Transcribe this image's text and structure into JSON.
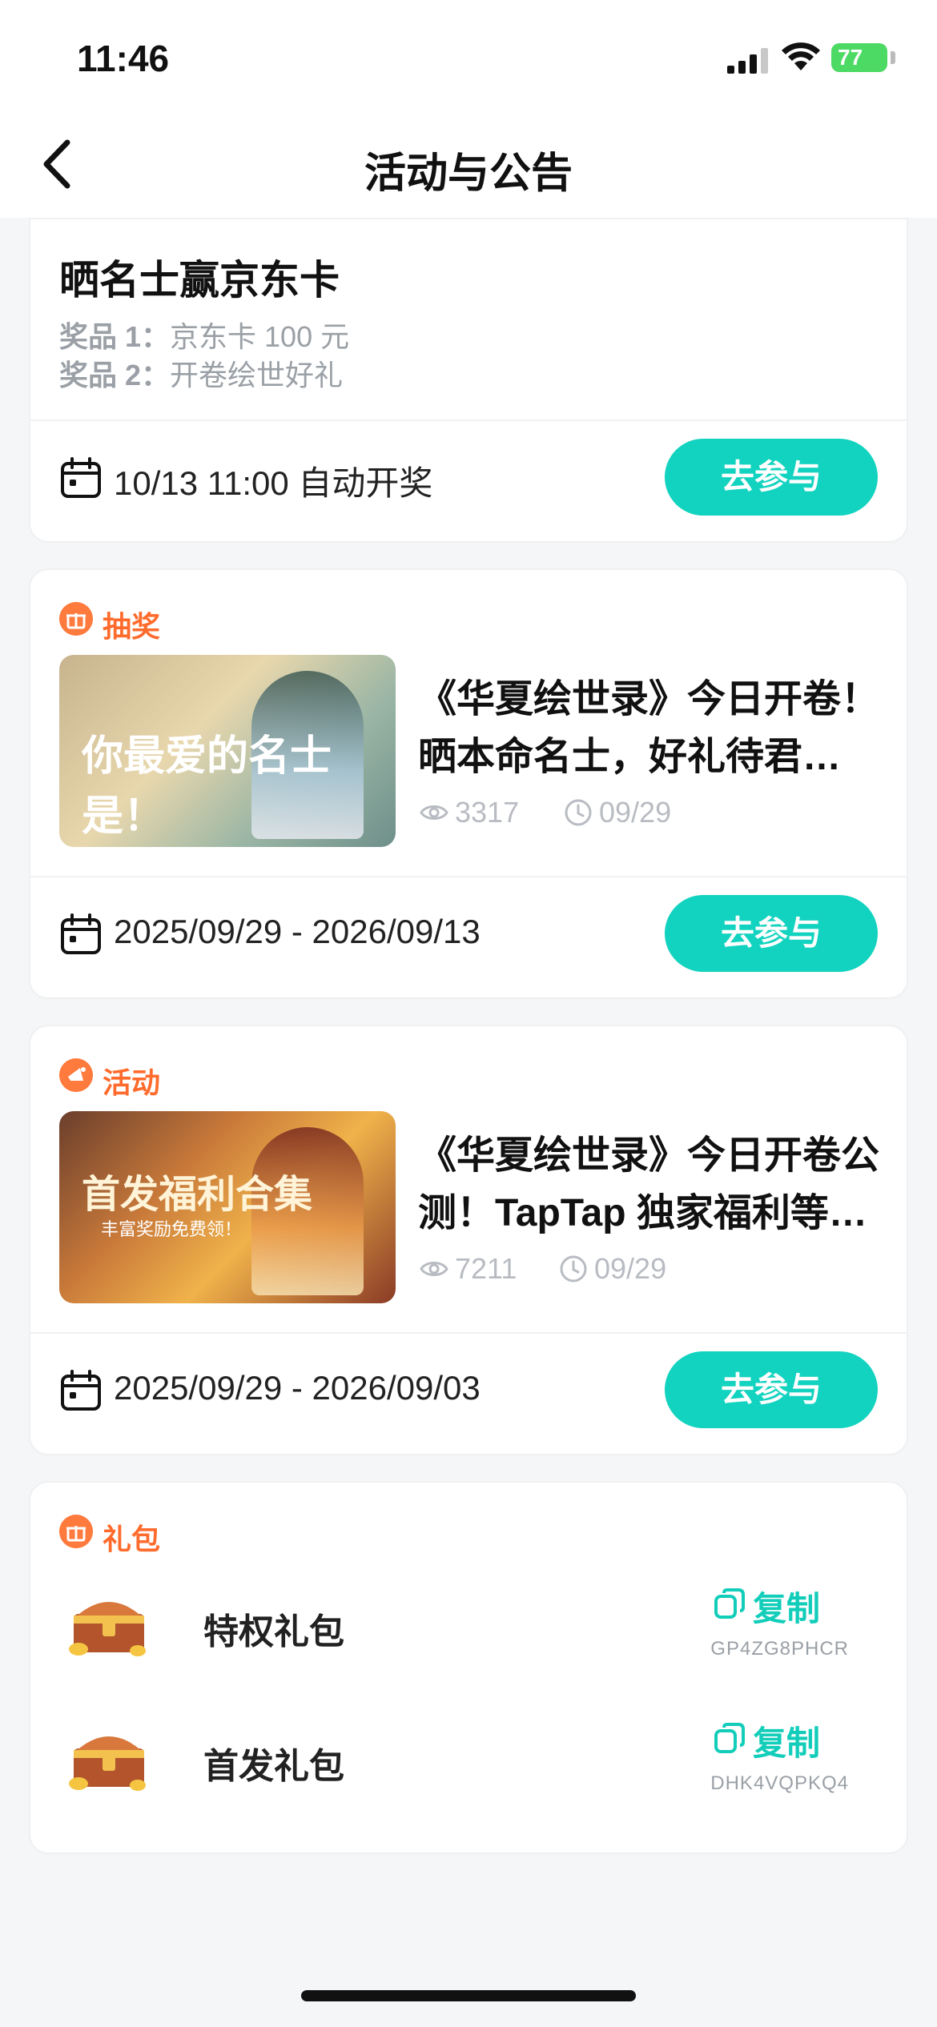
{
  "status": {
    "time": "11:46",
    "battery": "77"
  },
  "nav": {
    "title": "活动与公告"
  },
  "lottery_card": {
    "title": "晒名士赢京东卡",
    "prizes": [
      {
        "label": "奖品 1：",
        "value": "京东卡 100 元"
      },
      {
        "label": "奖品 2：",
        "value": "开卷绘世好礼"
      }
    ],
    "footer_text": "10/13 11:00 自动开奖",
    "button": "去参与"
  },
  "posts": [
    {
      "tag": "抽奖",
      "thumb_text": "你最爱的名士是！",
      "title_line1": "《华夏绘世录》今日开卷！",
      "title_line2": "晒本命名士，好礼待君…",
      "views": "3317",
      "date": "09/29",
      "period": "2025/09/29 - 2026/09/13",
      "button": "去参与"
    },
    {
      "tag": "活动",
      "thumb_text": "首发福利合集",
      "thumb_subtext": "丰富奖励免费领！",
      "title_line1": "《华夏绘世录》今日开卷公",
      "title_line2": "测！TapTap 独家福利等…",
      "views": "7211",
      "date": "09/29",
      "period": "2025/09/29 - 2026/09/03",
      "button": "去参与"
    }
  ],
  "gifts": {
    "tag": "礼包",
    "items": [
      {
        "name": "特权礼包",
        "copy_label": "复制",
        "code": "GP4ZG8PHCR"
      },
      {
        "name": "首发礼包",
        "copy_label": "复制",
        "code": "DHK4VQPKQ4"
      }
    ]
  },
  "colors": {
    "accent": "#12d3bf",
    "tag_orange": "#ff6b2c",
    "muted": "#9aa0a6"
  },
  "icons": [
    "signal-icon",
    "wifi-icon",
    "battery-icon",
    "back-chevron-icon",
    "calendar-icon",
    "gift-icon",
    "megaphone-icon",
    "eye-icon",
    "clock-icon",
    "copy-icon",
    "treasure-chest-icon"
  ]
}
